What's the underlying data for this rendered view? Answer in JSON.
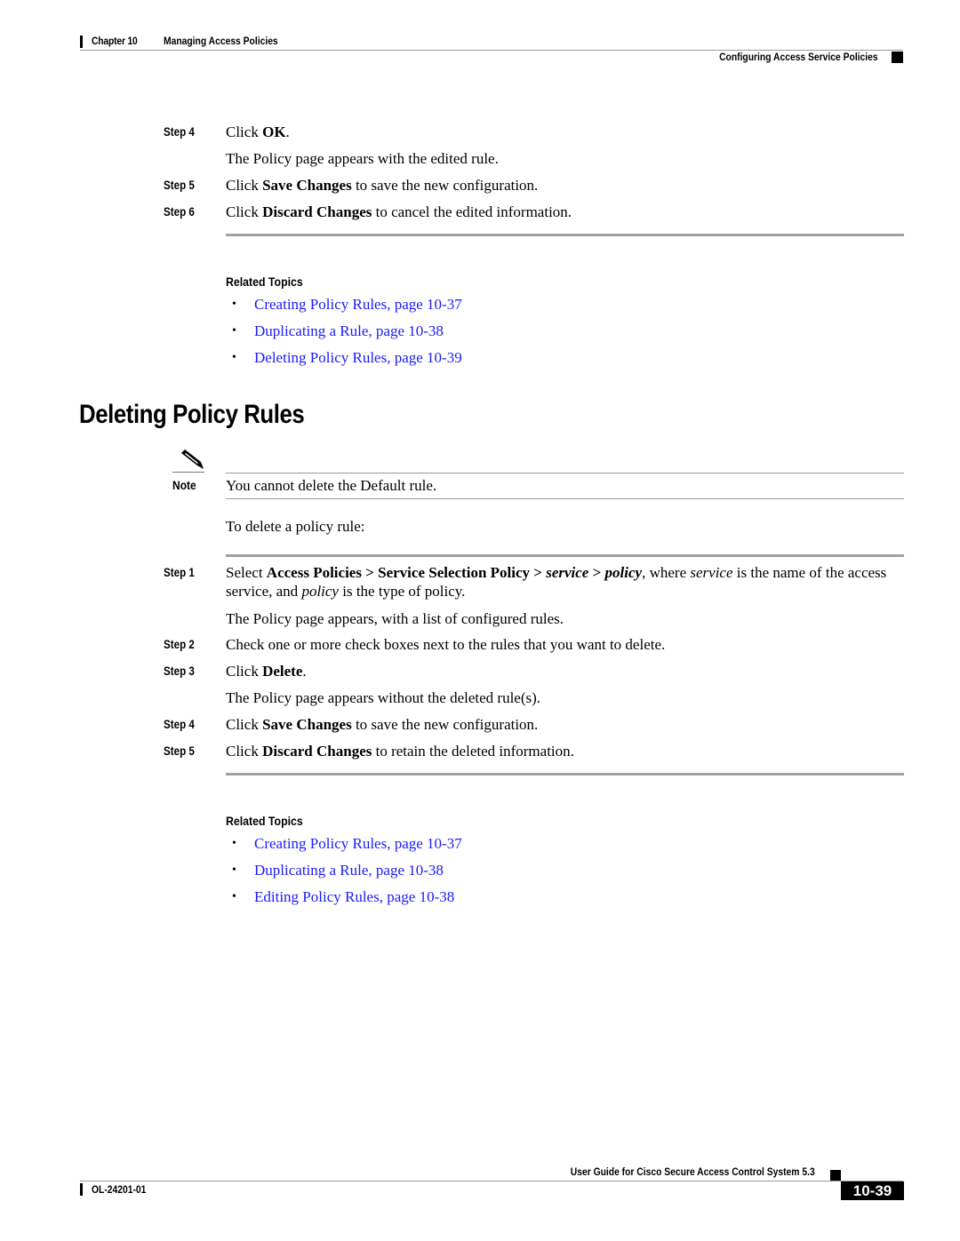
{
  "header": {
    "chapter": "Chapter 10",
    "chapter_title": "Managing Access Policies",
    "section": "Configuring Access Service Policies"
  },
  "top_steps": [
    {
      "label": "Step 4",
      "pre": "Click ",
      "bold": "OK",
      "post": ".",
      "sub": "The Policy page appears with the edited rule."
    },
    {
      "label": "Step 5",
      "pre": "Click ",
      "bold": "Save Changes",
      "post": " to save the new configuration."
    },
    {
      "label": "Step 6",
      "pre": "Click ",
      "bold": "Discard Changes",
      "post": " to cancel the edited information."
    }
  ],
  "related_topics_1": {
    "heading": "Related Topics",
    "links": [
      "Creating Policy Rules, page 10-37",
      "Duplicating a Rule, page 10-38",
      "Deleting Policy Rules, page 10-39"
    ]
  },
  "section": {
    "title": "Deleting Policy Rules",
    "note_label": "Note",
    "note_text": "You cannot delete the Default rule.",
    "intro": "To delete a policy rule:"
  },
  "steps": {
    "s1_label": "Step 1",
    "s1_select": "Select ",
    "s1_path1": "Access Policies > Service Selection Policy > ",
    "s1_service": "service",
    "s1_gt": " > ",
    "s1_policy": "policy",
    "s1_where": ", where ",
    "s1_service2": "service",
    "s1_rest1": " is the name of the access service, and ",
    "s1_policy2": "policy",
    "s1_rest2": " is the type of policy.",
    "s1_sub": "The Policy page appears, with a list of configured rules.",
    "s2_label": "Step 2",
    "s2_text": "Check one or more check boxes next to the rules that you want to delete.",
    "s3_label": "Step 3",
    "s3_pre": "Click ",
    "s3_bold": "Delete",
    "s3_post": ".",
    "s3_sub": "The Policy page appears without the deleted rule(s).",
    "s4_label": "Step 4",
    "s4_pre": "Click ",
    "s4_bold": "Save Changes",
    "s4_post": " to save the new configuration.",
    "s5_label": "Step 5",
    "s5_pre": "Click ",
    "s5_bold": "Discard Changes",
    "s5_post": " to retain the deleted information."
  },
  "related_topics_2": {
    "heading": "Related Topics",
    "links": [
      "Creating Policy Rules, page 10-37",
      "Duplicating a Rule, page 10-38",
      "Editing Policy Rules, page 10-38"
    ]
  },
  "footer": {
    "guide_title": "User Guide for Cisco Secure Access Control System 5.3",
    "doc_number": "OL-24201-01",
    "page_number": "10-39"
  },
  "colors": {
    "link": "#1a1aff",
    "rule_gray": "#a0a0a0"
  },
  "bullet_glyph": "•"
}
